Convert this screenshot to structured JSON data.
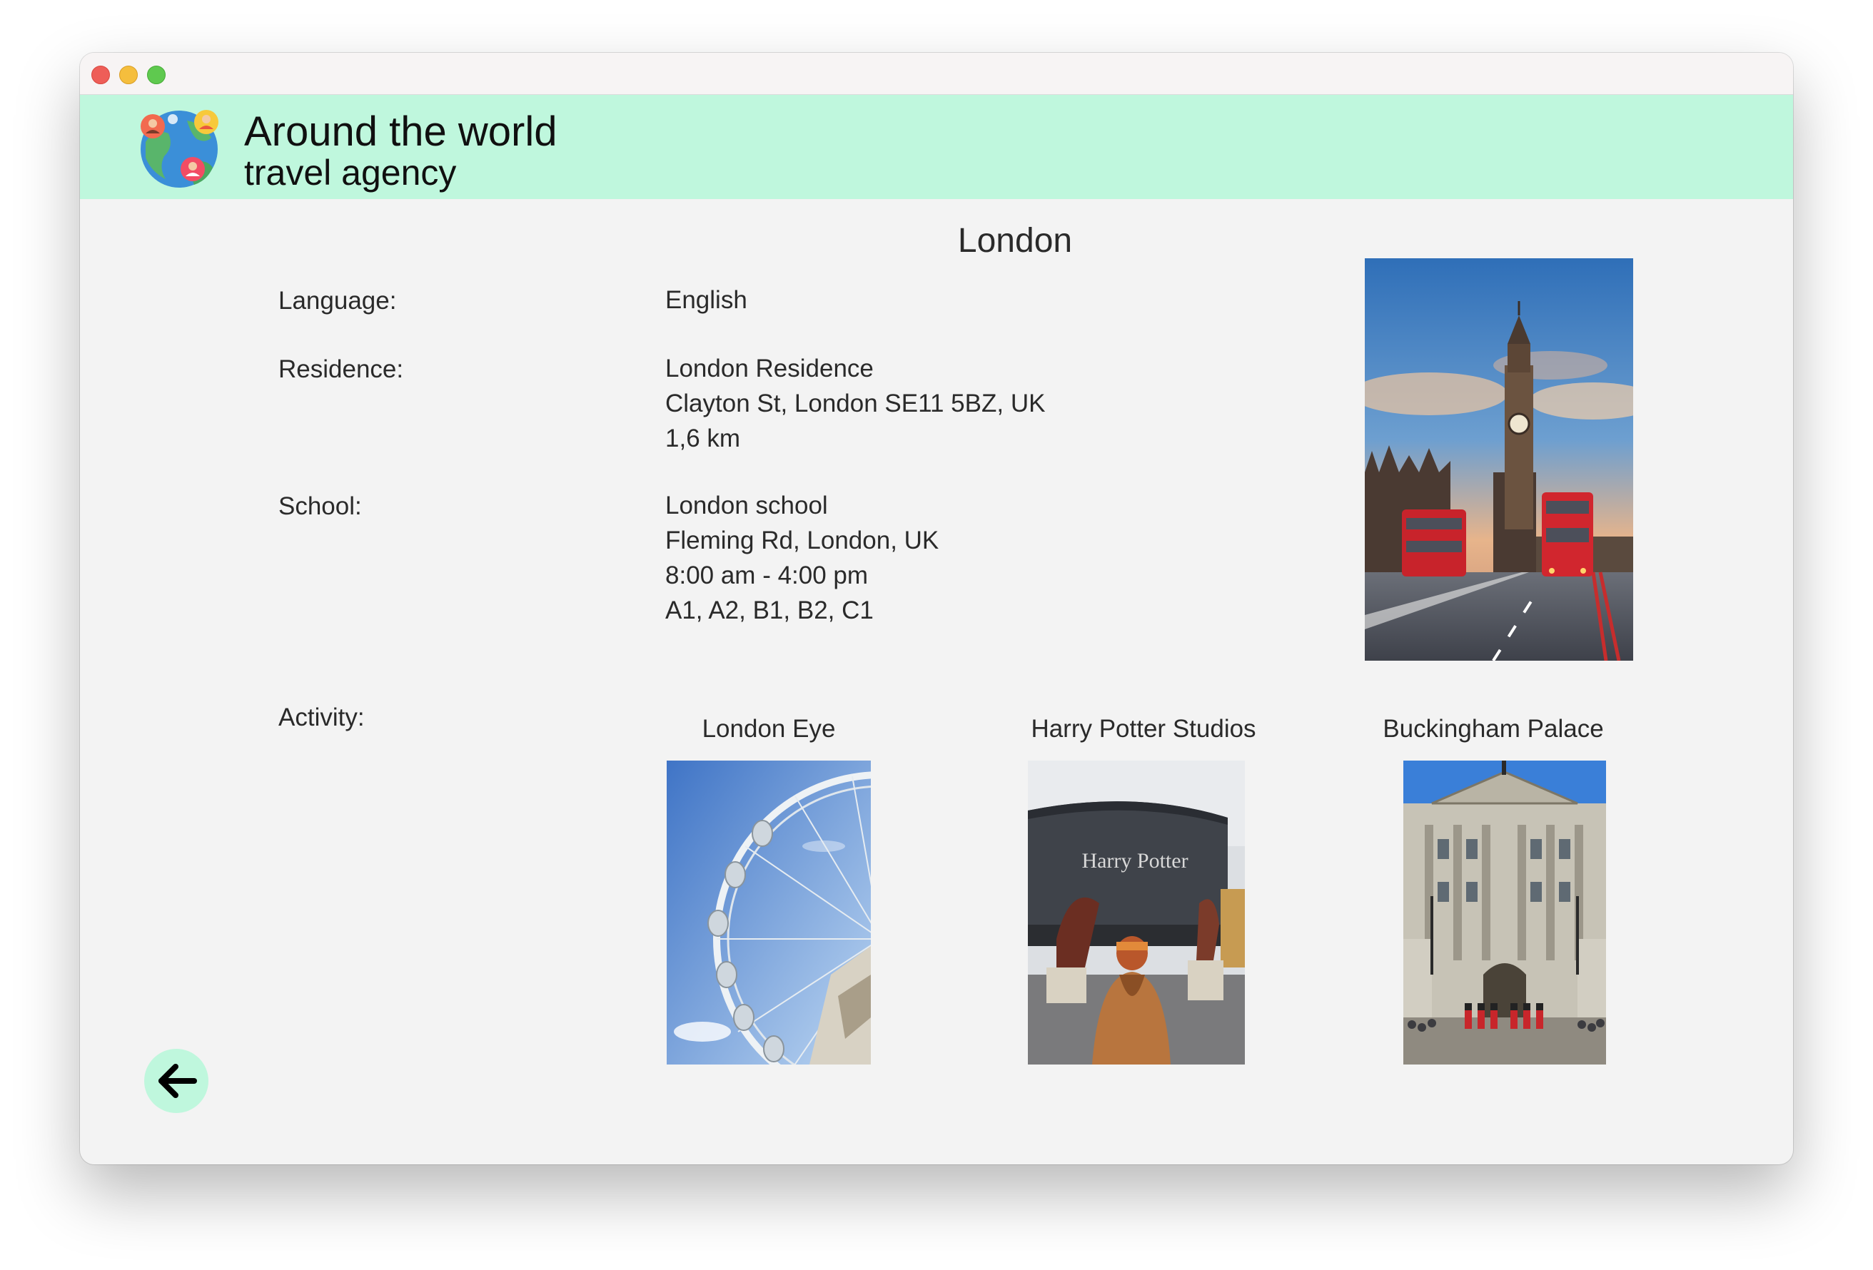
{
  "window": {
    "controls": [
      "close",
      "minimize",
      "maximize"
    ]
  },
  "header": {
    "title": "Around the world",
    "subtitle": "travel agency",
    "logo_icon": "globe-people-logo",
    "background": "#bff7dd"
  },
  "city": {
    "name": "London",
    "image": "big-ben-image"
  },
  "details": {
    "language": {
      "label": "Language:",
      "value": "English"
    },
    "residence": {
      "label": "Residence:",
      "lines": [
        "London Residence",
        "Clayton St, London SE11 5BZ, UK",
        "1,6 km"
      ]
    },
    "school": {
      "label": "School:",
      "lines": [
        "London school",
        "Fleming Rd, London, UK",
        "8:00 am - 4:00 pm",
        "A1, A2, B1, B2, C1"
      ]
    },
    "activity": {
      "label": "Activity:",
      "items": [
        {
          "name": "London Eye",
          "image": "london-eye-image"
        },
        {
          "name": "Harry Potter Studios",
          "image": "harry-potter-studios-image"
        },
        {
          "name": "Buckingham Palace",
          "image": "buckingham-palace-image"
        }
      ]
    }
  },
  "footer": {
    "back_icon": "arrow-left-icon"
  }
}
